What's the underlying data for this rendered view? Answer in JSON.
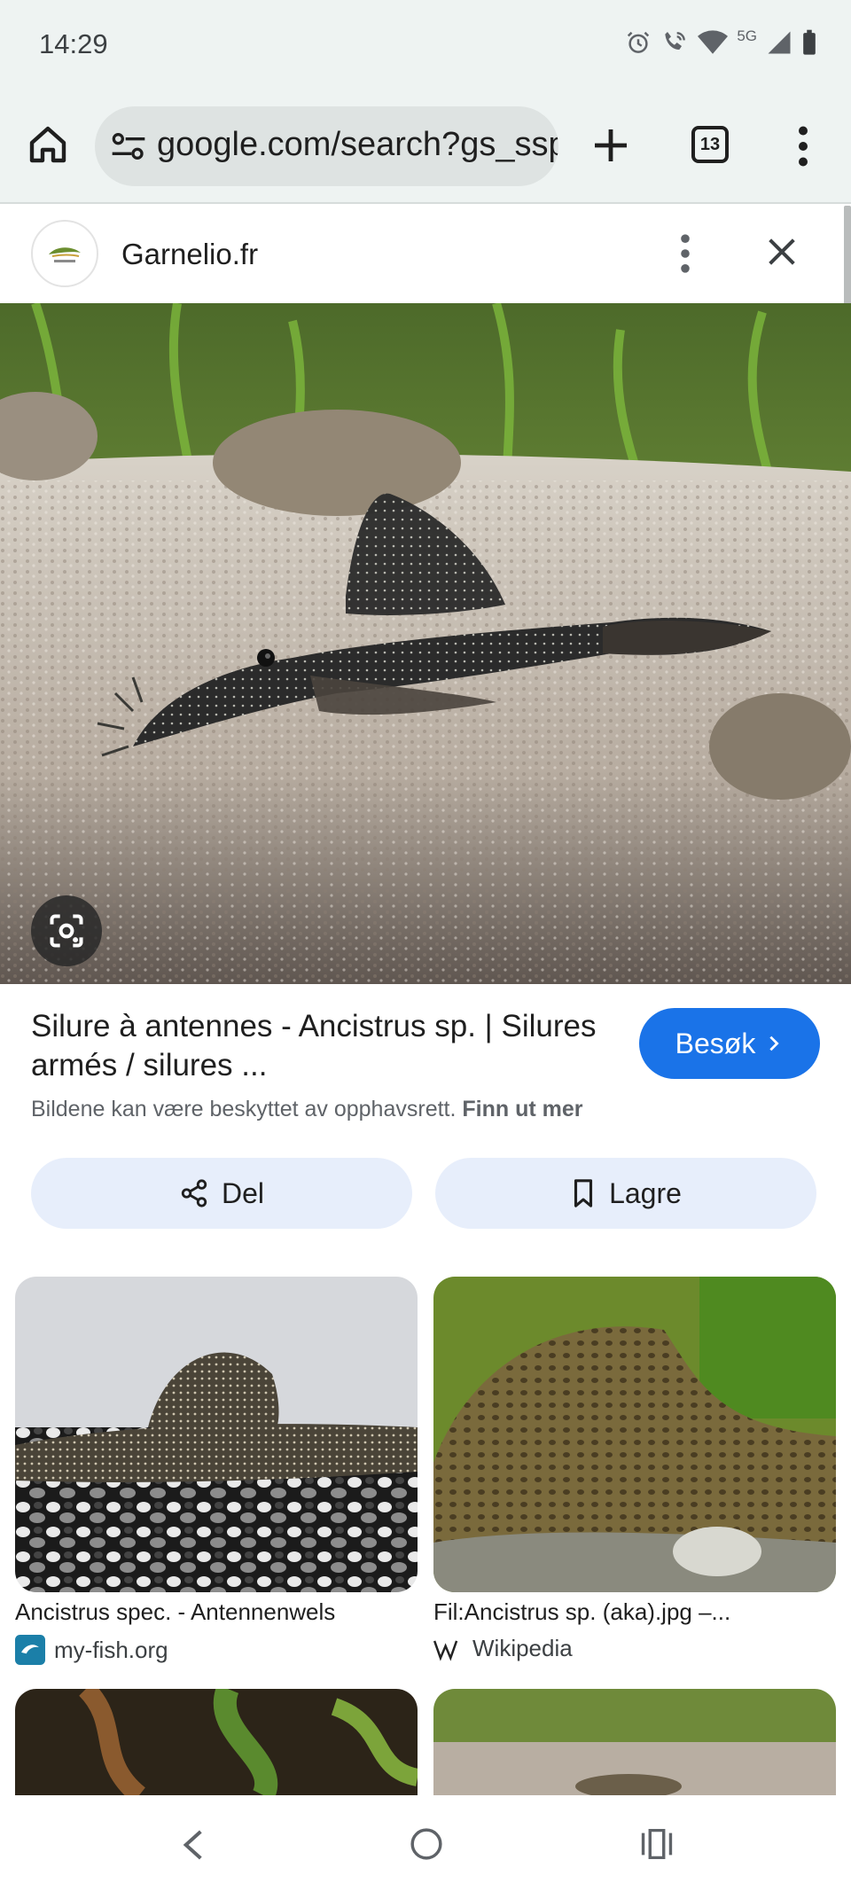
{
  "status_bar": {
    "time": "14:29",
    "network": "5G"
  },
  "browser": {
    "url": "google.com/search?gs_ssp",
    "tab_count": "13",
    "icons": [
      "home-icon",
      "page-info-icon",
      "plus-icon",
      "tabs-icon",
      "more-vert-icon"
    ]
  },
  "source": {
    "name": "Garnelio.fr"
  },
  "result": {
    "title": "Silure à antennes - Ancistrus sp. | Silures armés / silures ...",
    "visit_label": "Besøk",
    "copyright_text": "Bildene kan være beskyttet av opphavsrett.",
    "learn_more": "Finn ut mer",
    "share_label": "Del",
    "save_label": "Lagre"
  },
  "related": [
    {
      "title": "Ancistrus spec. - Antennenwels",
      "source": "my-fish.org"
    },
    {
      "title": "Fil:Ancistrus sp. (aka).jpg –...",
      "source": "Wikipedia"
    }
  ],
  "colors": {
    "accent": "#1a73e8",
    "chrome_bg": "#eef3f2",
    "pill_bg": "#e7eefb"
  }
}
